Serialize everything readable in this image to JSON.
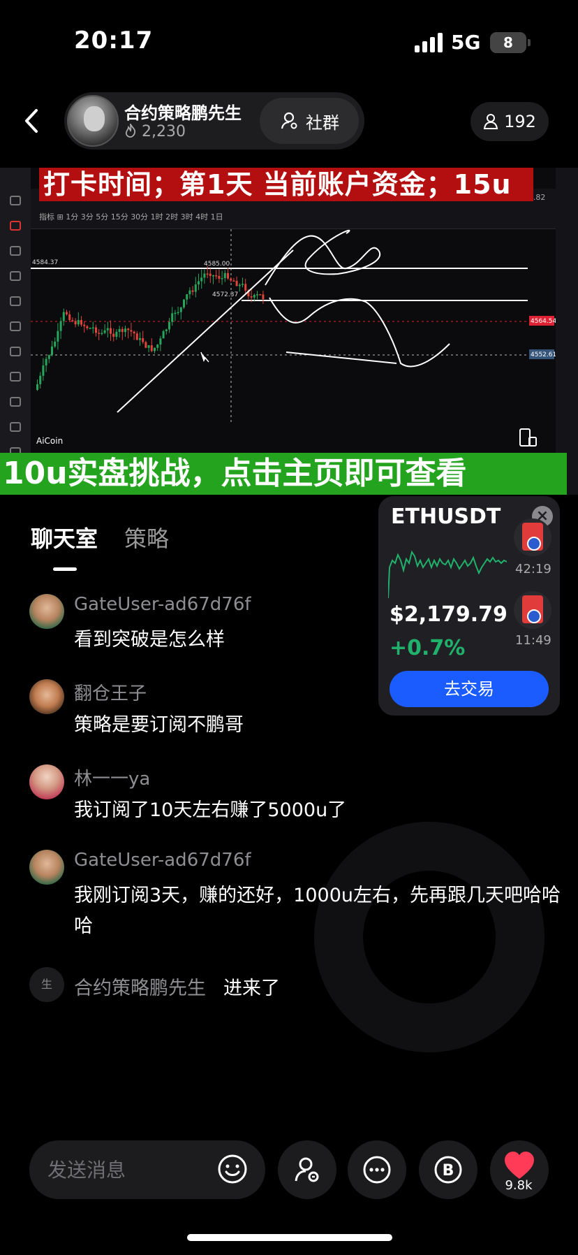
{
  "status_bar": {
    "time": "20:17",
    "network": "5G",
    "battery": "8"
  },
  "header": {
    "host_name": "合约策略鹏先生",
    "host_heat": "2,230",
    "community_label": "社群",
    "viewer_count": "192"
  },
  "video": {
    "banner_top": "打卡时间；第1天   当前账户资金；15u",
    "banner_bottom": "10u实盘挑战，点击主页即可查看",
    "watermark": "AiCoin",
    "price_labels": [
      "4584.37",
      "4585.00",
      "4572.37",
      "4564.54",
      "4552.61"
    ]
  },
  "tabs": {
    "chat": "聊天室",
    "strategy": "策略"
  },
  "messages": [
    {
      "user": "GateUser-ad67d76f",
      "text": "看到突破是怎么样"
    },
    {
      "user": "翻仓王子",
      "text": "策略是要订阅不鹏哥"
    },
    {
      "user": "林一一ya",
      "text": "我订阅了10天左右赚了5000u了"
    },
    {
      "user": "GateUser-ad67d76f",
      "text": "我刚订阅3天，赚的还好，1000u左右，先再跟几天吧哈哈哈"
    }
  ],
  "join_notice": {
    "avatar_char": "生",
    "user": "合约策略鹏先生",
    "text": "进来了"
  },
  "ticker_card": {
    "pair": "ETHUSDT",
    "price": "$2,179.79",
    "change": "+0.7%",
    "trade_label": "去交易",
    "red_envelope_times": [
      "42:19",
      "11:49"
    ],
    "accent_up": "#20b26c"
  },
  "bottom_bar": {
    "input_placeholder": "发送消息",
    "like_count": "9.8k",
    "like_color": "#ff3b57"
  }
}
